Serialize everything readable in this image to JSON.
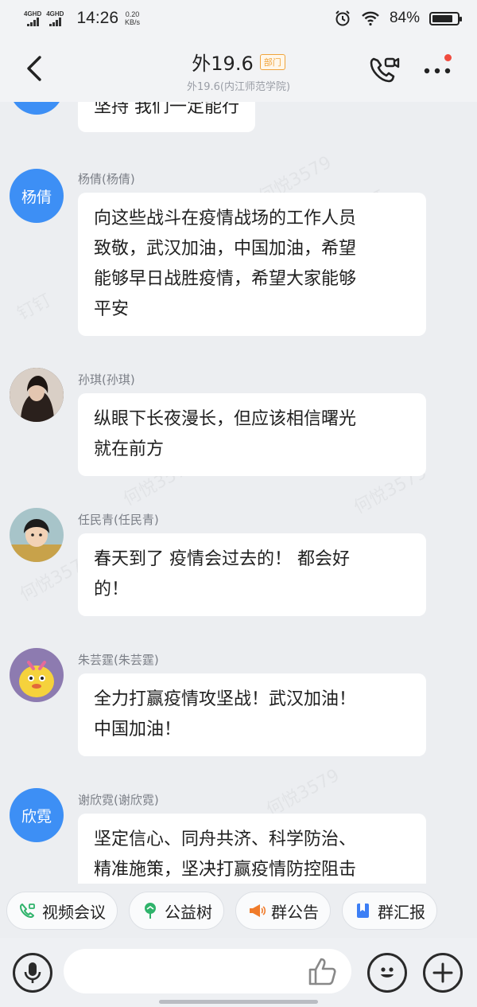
{
  "status_bar": {
    "network1": "4GHD",
    "network2": "4GHD",
    "time": "14:26",
    "speed_value": "0.20",
    "speed_unit": "KB/s",
    "battery": "84%",
    "battery_level": 0.84
  },
  "header": {
    "title": "外19.6",
    "badge": "部门",
    "subtitle": "外19.6(内江师范学院)",
    "notification_dot_color": "#f04b3e"
  },
  "watermark_texts": [
    "钉钉",
    "何悦3579"
  ],
  "messages": [
    {
      "sender": "",
      "avatar_text": "",
      "avatar_type": "text",
      "text": "坚持 我们一定能行"
    },
    {
      "sender": "杨倩(杨倩)",
      "avatar_text": "杨倩",
      "avatar_type": "text",
      "text_lines": [
        "向这些战斗在疫情战场的工作人员",
        "致敬，武汉加油，中国加油，希望",
        "能够早日战胜疫情，希望大家能够",
        "平安"
      ]
    },
    {
      "sender": "孙琪(孙琪)",
      "avatar_type": "photo",
      "text_lines": [
        "纵眼下长夜漫长，但应该相信曙光",
        "就在前方"
      ]
    },
    {
      "sender": "任民青(任民青)",
      "avatar_type": "cartoon",
      "text_lines": [
        "春天到了 疫情会过去的！ 都会好",
        "的！"
      ]
    },
    {
      "sender": "朱芸霆(朱芸霆)",
      "avatar_type": "cartoon",
      "text_lines": [
        "全力打赢疫情攻坚战！武汉加油！",
        "中国加油！"
      ]
    },
    {
      "sender": "谢欣霓(谢欣霓)",
      "avatar_text": "欣霓",
      "avatar_type": "text",
      "text_lines": [
        "坚定信心、同舟共济、科学防治、",
        "精准施策，坚决打赢疫情防控阻击"
      ]
    }
  ],
  "quick_actions": [
    {
      "label": "视频会议",
      "icon": "video-call-icon",
      "color": "#2fb36b"
    },
    {
      "label": "公益树",
      "icon": "tree-icon",
      "color": "#2fb36b"
    },
    {
      "label": "群公告",
      "icon": "megaphone-icon",
      "color": "#f07b2a"
    },
    {
      "label": "群汇报",
      "icon": "report-icon",
      "color": "#3d7ff5"
    }
  ],
  "input": {
    "placeholder": ""
  },
  "colors": {
    "avatar_blue": "#3d8ff5",
    "background": "#eceef1"
  }
}
